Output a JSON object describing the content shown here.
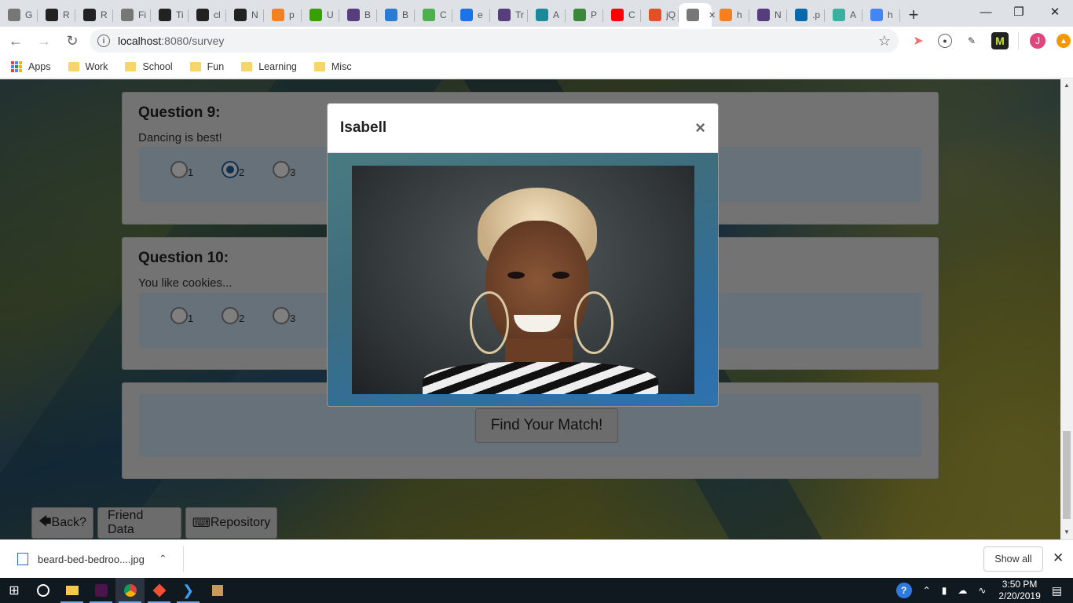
{
  "browser": {
    "tabs": [
      {
        "label": "G",
        "icon": "page-icon",
        "color": "#777777"
      },
      {
        "label": "R",
        "icon": "github-icon",
        "color": "#222222"
      },
      {
        "label": "R",
        "icon": "github-icon",
        "color": "#222222"
      },
      {
        "label": "Fi",
        "icon": "page-icon",
        "color": "#777777"
      },
      {
        "label": "Ti",
        "icon": "github-icon",
        "color": "#222222"
      },
      {
        "label": "cl",
        "icon": "github-icon",
        "color": "#222222"
      },
      {
        "label": "N",
        "icon": "github-icon",
        "color": "#222222"
      },
      {
        "label": "p",
        "icon": "stackoverflow-icon",
        "color": "#f48024"
      },
      {
        "label": "U",
        "icon": "upwork-icon",
        "color": "#37a000"
      },
      {
        "label": "B",
        "icon": "bootstrap-icon",
        "color": "#563d7c"
      },
      {
        "label": "B",
        "icon": "bootstrap-b-icon",
        "color": "#2b7bd4"
      },
      {
        "label": "C",
        "icon": "w3-icon",
        "color": "#4caf50"
      },
      {
        "label": "e",
        "icon": "flag-icon",
        "color": "#1a73e8"
      },
      {
        "label": "Tr",
        "icon": "bootstrap-icon",
        "color": "#563d7c"
      },
      {
        "label": "A",
        "icon": "grad-cap-icon",
        "color": "#1a8a9a"
      },
      {
        "label": "P",
        "icon": "node-icon",
        "color": "#3c873a"
      },
      {
        "label": "C",
        "icon": "youtube-icon",
        "color": "#ff0000"
      },
      {
        "label": "jQ",
        "icon": "html5-icon",
        "color": "#e34f26"
      },
      {
        "label": "",
        "icon": "page-icon",
        "color": "#777777",
        "active": true
      },
      {
        "label": "h",
        "icon": "stackoverflow-icon",
        "color": "#f48024"
      },
      {
        "label": "N",
        "icon": "bootstrap-icon",
        "color": "#563d7c"
      },
      {
        "label": ".p",
        "icon": "jquery-icon",
        "color": "#0769ad"
      },
      {
        "label": "A",
        "icon": "d-icon",
        "color": "#3ab09e"
      },
      {
        "label": "h",
        "icon": "google-icon",
        "color": "#4285f4"
      }
    ],
    "url_host": "localhost",
    "url_path": ":8080/survey",
    "bookmarks": {
      "apps": "Apps",
      "folders": [
        "Work",
        "School",
        "Fun",
        "Learning",
        "Misc"
      ]
    },
    "profile_initial": "J"
  },
  "survey": {
    "q9": {
      "title": "Question 9:",
      "text": "Dancing is best!",
      "options": [
        "1",
        "2",
        "3"
      ],
      "selected": "2"
    },
    "q10": {
      "title": "Question 10:",
      "text": "You like cookies...",
      "options": [
        "1",
        "2",
        "3"
      ]
    },
    "submit_label": "Find Your Match!",
    "footer": {
      "back": "Back?",
      "friend_data": "Friend Data",
      "repository": "Repository"
    }
  },
  "modal": {
    "title": "Isabell",
    "close": "×"
  },
  "download": {
    "file": "beard-bed-bedroo....jpg",
    "show_all": "Show all",
    "close": "✕"
  },
  "taskbar": {
    "time": "3:50 PM",
    "date": "2/20/2019"
  },
  "colors": {
    "accent": "#1e5fa8",
    "well": "#cfe2f5"
  }
}
